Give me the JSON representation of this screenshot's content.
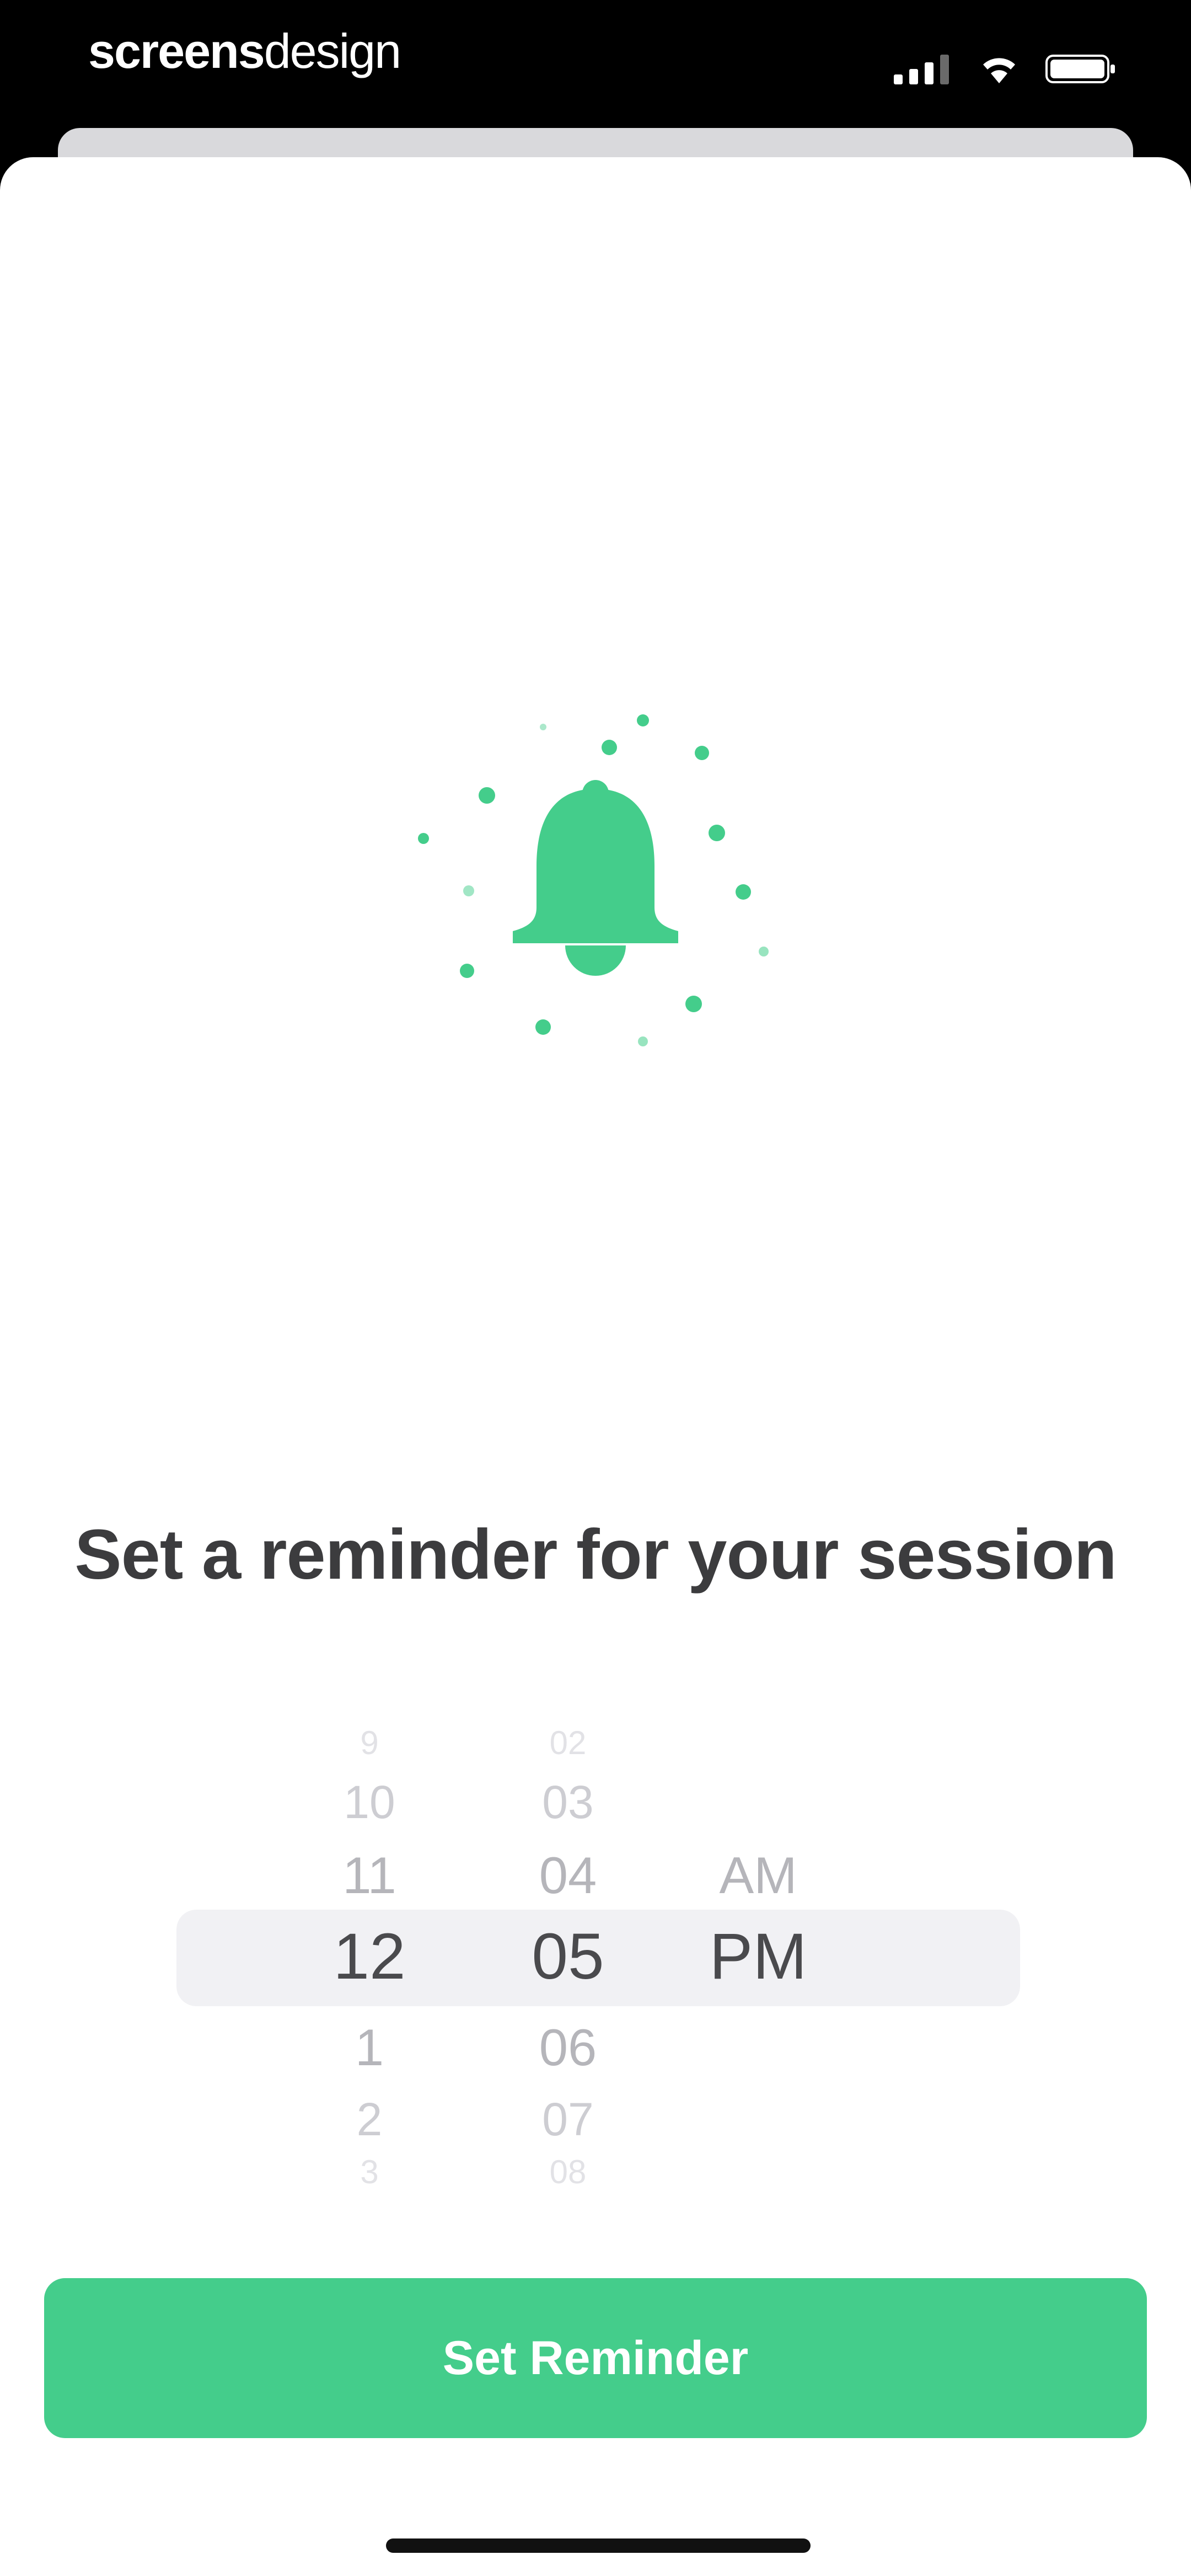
{
  "status_bar": {
    "brand_part1": "screens",
    "brand_part2": "design",
    "icons": [
      "signal-icon",
      "wifi-icon",
      "battery-icon"
    ]
  },
  "illustration": {
    "icon": "bell-icon",
    "accent_color": "#44cd8b"
  },
  "title": "Set a reminder for your session",
  "time_picker": {
    "hours": {
      "above": [
        "9",
        "10",
        "11"
      ],
      "selected": "12",
      "below": [
        "1",
        "2",
        "3"
      ]
    },
    "minutes": {
      "above": [
        "02",
        "03",
        "04"
      ],
      "selected": "05",
      "below": [
        "06",
        "07",
        "08"
      ]
    },
    "period": {
      "above": [
        "AM"
      ],
      "selected": "PM"
    }
  },
  "button": {
    "label": "Set Reminder",
    "color": "#44cd8b"
  }
}
